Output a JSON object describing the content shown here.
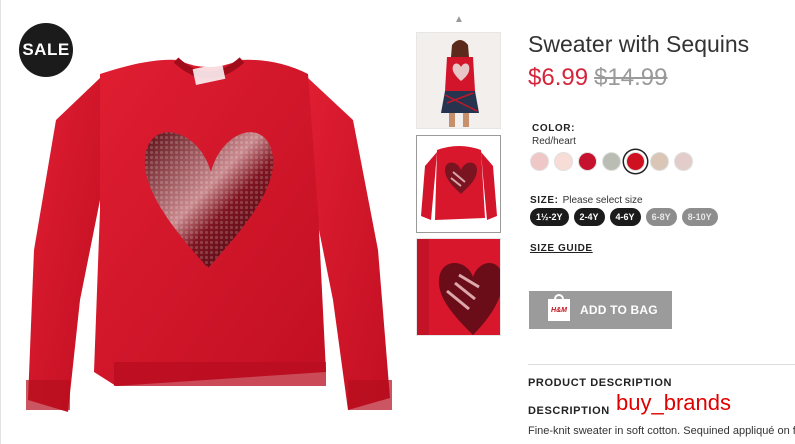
{
  "badge": {
    "sale": "SALE"
  },
  "product": {
    "title": "Sweater with Sequins",
    "price_current": "$6.99",
    "price_original": "$14.99"
  },
  "color": {
    "label": "COLOR:",
    "selected": "Red/heart",
    "swatches": [
      {
        "name": "light-pink",
        "hex": "#efc7c6"
      },
      {
        "name": "pale-peach",
        "hex": "#f7ddd6"
      },
      {
        "name": "red",
        "hex": "#c4122f"
      },
      {
        "name": "grey-green",
        "hex": "#b9bdb4"
      },
      {
        "name": "red-heart",
        "hex": "#cf1020",
        "selected": true
      },
      {
        "name": "beige",
        "hex": "#d9c6b7"
      },
      {
        "name": "blush",
        "hex": "#e3cdca"
      }
    ]
  },
  "size": {
    "label": "SIZE:",
    "hint": "Please select size",
    "options": [
      {
        "label": "1½-2Y",
        "available": true
      },
      {
        "label": "2-4Y",
        "available": true
      },
      {
        "label": "4-6Y",
        "available": true
      },
      {
        "label": "6-8Y",
        "available": false
      },
      {
        "label": "8-10Y",
        "available": false
      }
    ],
    "guide": "SIZE GUIDE"
  },
  "cart": {
    "add_label": "ADD TO BAG",
    "bag_logo": "H&M"
  },
  "description": {
    "section_heading": "PRODUCT DESCRIPTION",
    "heading": "DESCRIPTION",
    "text": "Fine-knit sweater in soft cotton. Sequined appliqué on front, ribbing at neckline, cuffs, and hem. Slits at sides, and slightly longer back section."
  },
  "watermark": "buy_brands",
  "colors": {
    "sale_price": "#d4263b",
    "old_price": "#9a9a9a",
    "button": "#9b9b9b",
    "sweater": "#d2152a"
  }
}
